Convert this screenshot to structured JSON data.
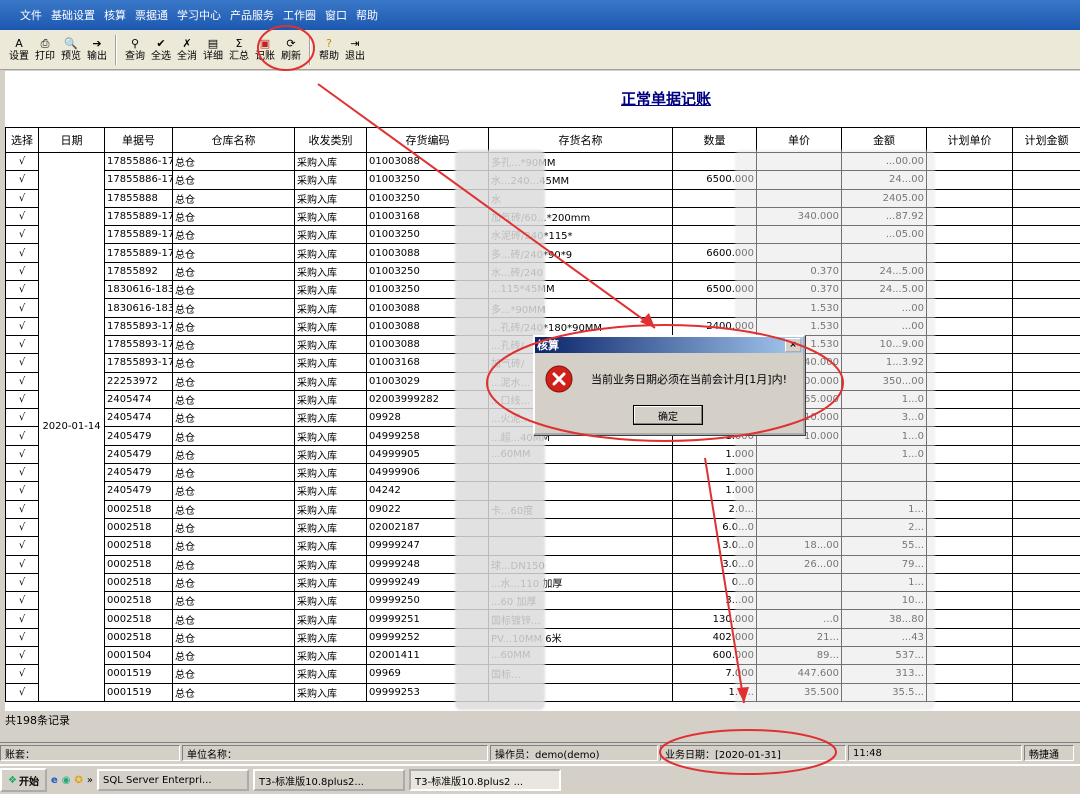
{
  "menu": [
    "文件",
    "基础设置",
    "核算",
    "票据通",
    "学习中心",
    "产品服务",
    "工作圈",
    "窗口",
    "帮助"
  ],
  "toolbar": [
    {
      "label": "设置",
      "icon": "settings-icon"
    },
    {
      "label": "打印",
      "icon": "printer-icon"
    },
    {
      "label": "预览",
      "icon": "preview-icon"
    },
    {
      "label": "输出",
      "icon": "export-icon"
    },
    {
      "label": "查询",
      "icon": "binoculars-icon"
    },
    {
      "label": "全选",
      "icon": "select-all-icon"
    },
    {
      "label": "全消",
      "icon": "deselect-all-icon"
    },
    {
      "label": "详细",
      "icon": "detail-icon"
    },
    {
      "label": "汇总",
      "icon": "summary-icon"
    },
    {
      "label": "记账",
      "icon": "post-ledger-icon"
    },
    {
      "label": "刷新",
      "icon": "refresh-icon"
    },
    {
      "label": "帮助",
      "icon": "help-icon"
    },
    {
      "label": "退出",
      "icon": "exit-icon"
    }
  ],
  "page_title": "正常单据记账",
  "columns": [
    "选择",
    "日期",
    "单据号",
    "仓库名称",
    "收发类别",
    "存货编码",
    "存货名称",
    "数量",
    "单价",
    "金额",
    "计划单价",
    "计划金额"
  ],
  "date_value": "2020-01-14",
  "rows": [
    {
      "sel": "√",
      "doc": "17855886-178",
      "wh": "总仓",
      "type": "采购入库",
      "code": "01003088",
      "name": "多孔...*90MM",
      "qty": "",
      "price": "",
      "amt": "...00.00"
    },
    {
      "sel": "√",
      "doc": "17855886-178",
      "wh": "总仓",
      "type": "采购入库",
      "code": "01003250",
      "name": "水...240...45MM",
      "qty": "6500.000",
      "price": "",
      "amt": "24...00"
    },
    {
      "sel": "√",
      "doc": "17855888",
      "wh": "总仓",
      "type": "采购入库",
      "code": "01003250",
      "name": "水",
      "qty": "",
      "price": "",
      "amt": "2405.00"
    },
    {
      "sel": "√",
      "doc": "17855889-178",
      "wh": "总仓",
      "type": "采购入库",
      "code": "01003168",
      "name": "加气砖/60...*200mm",
      "qty": "",
      "price": "340.000",
      "amt": "...87.92"
    },
    {
      "sel": "√",
      "doc": "17855889-178",
      "wh": "总仓",
      "type": "采购入库",
      "code": "01003250",
      "name": "水泥砖/240*115*",
      "qty": "",
      "price": "",
      "amt": "...05.00"
    },
    {
      "sel": "√",
      "doc": "17855889-178",
      "wh": "总仓",
      "type": "采购入库",
      "code": "01003088",
      "name": "多...砖/240*90*9",
      "qty": "6600.000",
      "price": "",
      "amt": ""
    },
    {
      "sel": "√",
      "doc": "17855892",
      "wh": "总仓",
      "type": "采购入库",
      "code": "01003250",
      "name": "水...砖/240",
      "qty": "",
      "price": "0.370",
      "amt": "24...5.00"
    },
    {
      "sel": "√",
      "doc": "1830616-1830",
      "wh": "总仓",
      "type": "采购入库",
      "code": "01003250",
      "name": "...115*45MM",
      "qty": "6500.000",
      "price": "0.370",
      "amt": "24...5.00"
    },
    {
      "sel": "√",
      "doc": "1830616-1830",
      "wh": "总仓",
      "type": "采购入库",
      "code": "01003088",
      "name": "多...*90MM",
      "qty": "",
      "price": "1.530",
      "amt": "...00"
    },
    {
      "sel": "√",
      "doc": "17855893-178",
      "wh": "总仓",
      "type": "采购入库",
      "code": "01003088",
      "name": "...孔砖/240*180*90MM",
      "qty": "2400.000",
      "price": "1.530",
      "amt": "...00"
    },
    {
      "sel": "√",
      "doc": "17855893-178",
      "wh": "总仓",
      "type": "采购入库",
      "code": "01003088",
      "name": "...孔砖/",
      "qty": "",
      "price": "1.530",
      "amt": "10...9.00"
    },
    {
      "sel": "√",
      "doc": "17855893-178",
      "wh": "总仓",
      "type": "采购入库",
      "code": "01003168",
      "name": "加气砖/",
      "qty": "",
      "price": "340.000",
      "amt": "1...3.92"
    },
    {
      "sel": "√",
      "doc": "22253972",
      "wh": "总仓",
      "type": "采购入库",
      "code": "01003029",
      "name": "...泥水...",
      "qty": "",
      "price": "700.000",
      "amt": "350...00"
    },
    {
      "sel": "√",
      "doc": "2405474",
      "wh": "总仓",
      "type": "采购入库",
      "code": "02003999282",
      "name": "...口线...",
      "qty": "",
      "price": "65.000",
      "amt": "1...0"
    },
    {
      "sel": "√",
      "doc": "2405474",
      "wh": "总仓",
      "type": "采购入库",
      "code": "09928",
      "name": "...火泥...",
      "qty": "",
      "price": "10.000",
      "amt": "3...0"
    },
    {
      "sel": "√",
      "doc": "2405479",
      "wh": "总仓",
      "type": "采购入库",
      "code": "04999258",
      "name": "...超...40MM",
      "qty": "1.000",
      "price": "10.000",
      "amt": "1...0"
    },
    {
      "sel": "√",
      "doc": "2405479",
      "wh": "总仓",
      "type": "采购入库",
      "code": "04999905",
      "name": "...60MM",
      "qty": "1.000",
      "price": "",
      "amt": "1...0"
    },
    {
      "sel": "√",
      "doc": "2405479",
      "wh": "总仓",
      "type": "采购入库",
      "code": "04999906",
      "name": "",
      "qty": "1.000",
      "price": "",
      "amt": ""
    },
    {
      "sel": "√",
      "doc": "2405479",
      "wh": "总仓",
      "type": "采购入库",
      "code": "04242",
      "name": "",
      "qty": "1.000",
      "price": "",
      "amt": ""
    },
    {
      "sel": "√",
      "doc": "0002518",
      "wh": "总仓",
      "type": "采购入库",
      "code": "09022",
      "name": "卡...60度",
      "qty": "2.0...",
      "price": "",
      "amt": "1..."
    },
    {
      "sel": "√",
      "doc": "0002518",
      "wh": "总仓",
      "type": "采购入库",
      "code": "02002187",
      "name": "",
      "qty": "6.0...0",
      "price": "",
      "amt": "2..."
    },
    {
      "sel": "√",
      "doc": "0002518",
      "wh": "总仓",
      "type": "采购入库",
      "code": "09999247",
      "name": "",
      "qty": "3.0...0",
      "price": "18...00",
      "amt": "55..."
    },
    {
      "sel": "√",
      "doc": "0002518",
      "wh": "总仓",
      "type": "采购入库",
      "code": "09999248",
      "name": "球...DN150",
      "qty": "3.0...0",
      "price": "26...00",
      "amt": "79..."
    },
    {
      "sel": "√",
      "doc": "0002518",
      "wh": "总仓",
      "type": "采购入库",
      "code": "09999249",
      "name": "...水...110 加厚",
      "qty": "0...0",
      "price": "",
      "amt": "1..."
    },
    {
      "sel": "√",
      "doc": "0002518",
      "wh": "总仓",
      "type": "采购入库",
      "code": "09999250",
      "name": "...60 加厚",
      "qty": "3...00",
      "price": "",
      "amt": "10..."
    },
    {
      "sel": "√",
      "doc": "0002518",
      "wh": "总仓",
      "type": "采购入库",
      "code": "09999251",
      "name": "国标镀锌...",
      "qty": "130.000",
      "price": "...0",
      "amt": "38...80"
    },
    {
      "sel": "√",
      "doc": "0002518",
      "wh": "总仓",
      "type": "采购入库",
      "code": "09999252",
      "name": "PV...10MM 6米",
      "qty": "402.000",
      "price": "21...",
      "amt": "...43"
    },
    {
      "sel": "√",
      "doc": "0001504",
      "wh": "总仓",
      "type": "采购入库",
      "code": "02001411",
      "name": "...60MM",
      "qty": "600.000",
      "price": "89...",
      "amt": "537..."
    },
    {
      "sel": "√",
      "doc": "0001519",
      "wh": "总仓",
      "type": "采购入库",
      "code": "09969",
      "name": "国标...",
      "qty": "7.000",
      "price": "447.600",
      "amt": "313..."
    },
    {
      "sel": "√",
      "doc": "0001519",
      "wh": "总仓",
      "type": "采购入库",
      "code": "09999253",
      "name": "",
      "qty": "1.0...",
      "price": "35.500",
      "amt": "35.5..."
    }
  ],
  "record_count": "共198条记录",
  "dialog": {
    "title": "核算",
    "message": "当前业务日期必须在当前会计月[1月]内!",
    "ok": "确定",
    "close": "×"
  },
  "status": {
    "account": "账套：",
    "unit": "单位名称：",
    "operator": "操作员：demo(demo)",
    "business_date": "业务日期：[2020-01-31]",
    "time": "11:48",
    "extra": "畅捷通"
  },
  "taskbar": {
    "start": "开始",
    "quick": "»",
    "tasks": [
      "SQL Server Enterpri...",
      "T3-标准版10.8plus2...",
      "T3-标准版10.8plus2 ..."
    ]
  },
  "colors": {
    "menubar": "#1d58b0",
    "title": "#000080",
    "annotation": "#e03030",
    "dialog_title": "#0a246a"
  }
}
